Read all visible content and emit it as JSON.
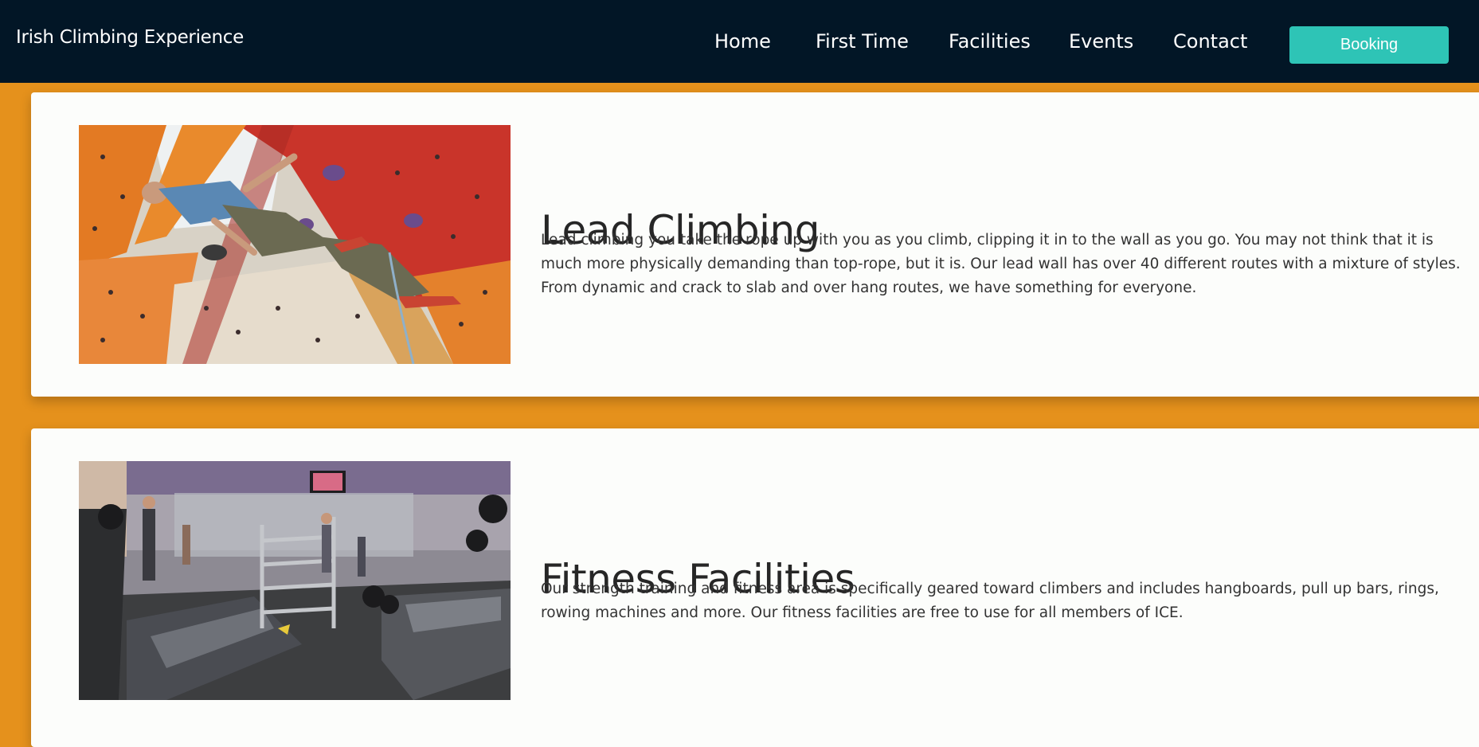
{
  "brand": "Irish Climbing Experience",
  "nav": {
    "home": "Home",
    "first_time": "First Time",
    "facilities": "Facilities",
    "events": "Events",
    "contact": "Contact",
    "booking": "Booking"
  },
  "sections": [
    {
      "title": "Lead Climbing",
      "text": "Lead climbing you take the rope up with you as you climb, clipping it in to the wall as you go. You may not think that it is much more physically demanding than top-rope, but it is. Our lead wall has over 40 different routes with a mixture of styles. From dynamic and crack to slab and over hang routes, we have something for everyone."
    },
    {
      "title": "Fitness Facilities",
      "text": "Our strength training and fitness area is specifically geared toward climbers and includes hangboards, pull up bars, rings, rowing machines and more. Our fitness facilities are free to use for all members of ICE."
    }
  ],
  "colors": {
    "navbar": "#021626",
    "page_background": "#e5911c",
    "booking_button": "#2ec4b6",
    "card_background": "#fcfdfb"
  }
}
